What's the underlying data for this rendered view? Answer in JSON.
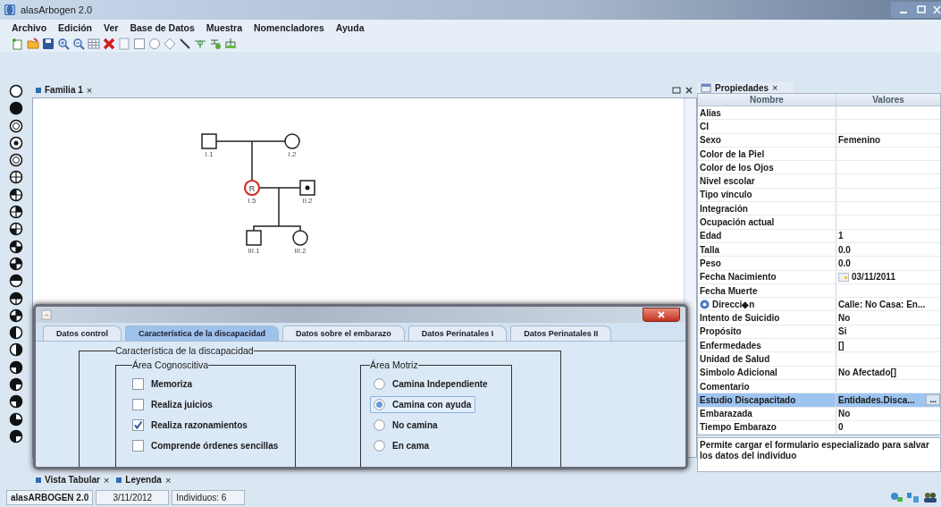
{
  "window": {
    "title": "alasArbogen 2.0"
  },
  "menu": [
    "Archivo",
    "Edición",
    "Ver",
    "Base de Datos",
    "Muestra",
    "Nomencladores",
    "Ayuda"
  ],
  "document_tab": {
    "label": "Familia 1",
    "close": "×"
  },
  "pedigree": {
    "individuals": [
      {
        "label": "I.1",
        "kind": "male",
        "affected": false,
        "highlighted": false
      },
      {
        "label": "I.2",
        "kind": "female",
        "affected": false,
        "highlighted": false
      },
      {
        "label": "I.5",
        "kind": "female",
        "affected": false,
        "highlighted": true,
        "marker": "R"
      },
      {
        "label": "II.2",
        "kind": "male",
        "affected": true,
        "highlighted": false
      },
      {
        "label": "III.1",
        "kind": "male",
        "affected": false,
        "highlighted": false
      },
      {
        "label": "III.2",
        "kind": "female",
        "affected": false,
        "highlighted": false
      }
    ]
  },
  "dialog": {
    "tabs": [
      {
        "label": "Datos control",
        "selected": false
      },
      {
        "label": "Característica de la discapacidad",
        "selected": true
      },
      {
        "label": "Datos sobre el embarazo",
        "selected": false
      },
      {
        "label": "Datos Perinatales I",
        "selected": false
      },
      {
        "label": "Datos Perinatales II",
        "selected": false
      }
    ],
    "frame_title": "Característica de la discapacidad",
    "groups": [
      {
        "title": "Área Cognoscitiva",
        "kind": "checkbox",
        "options": [
          {
            "label": "Memoriza",
            "checked": false
          },
          {
            "label": "Realiza juicios",
            "checked": false
          },
          {
            "label": "Realiza razonamientos",
            "checked": true
          },
          {
            "label": "Comprende órdenes sencillas",
            "checked": false
          }
        ]
      },
      {
        "title": "Área Motriz",
        "kind": "radio",
        "options": [
          {
            "label": "Camina Independiente",
            "selected": false
          },
          {
            "label": "Camina con ayuda",
            "selected": true
          },
          {
            "label": "No camina",
            "selected": false
          },
          {
            "label": "En cama",
            "selected": false
          }
        ]
      }
    ]
  },
  "properties": {
    "tab": "Propiedades",
    "close": "×",
    "columns": [
      "Nombre",
      "Valores"
    ],
    "rows": [
      {
        "name": "Alias",
        "value": "",
        "kind": "plain",
        "selected": false
      },
      {
        "name": "CI",
        "value": "",
        "kind": "plain",
        "selected": false
      },
      {
        "name": "Sexo",
        "value": "Femenino",
        "kind": "plain",
        "selected": false
      },
      {
        "name": "Color de la Piel",
        "value": "",
        "kind": "plain",
        "selected": false
      },
      {
        "name": "Color de los Ojos",
        "value": "",
        "kind": "plain",
        "selected": false
      },
      {
        "name": "Nivel escolar",
        "value": "",
        "kind": "plain",
        "selected": false
      },
      {
        "name": "Tipo vínculo",
        "value": "",
        "kind": "plain",
        "selected": false
      },
      {
        "name": "Integración",
        "value": "",
        "kind": "plain",
        "selected": false
      },
      {
        "name": "Ocupación actual",
        "value": "",
        "kind": "plain",
        "selected": false
      },
      {
        "name": "Edad",
        "value": "1",
        "kind": "plain",
        "selected": false
      },
      {
        "name": "Talla",
        "value": "0.0",
        "kind": "plain",
        "selected": false
      },
      {
        "name": "Peso",
        "value": "0.0",
        "kind": "plain",
        "selected": false
      },
      {
        "name": "Fecha Nacimiento",
        "value": "03/11/2011",
        "kind": "date",
        "selected": false
      },
      {
        "name": "Fecha Muerte",
        "value": "",
        "kind": "plain",
        "selected": false
      },
      {
        "name": "Direcci◆n",
        "value": "Calle:  No Casa:  En...",
        "kind": "group",
        "selected": false
      },
      {
        "name": "Intento de Suicidio",
        "value": "No",
        "kind": "plain",
        "selected": false
      },
      {
        "name": "Propósito",
        "value": "Si",
        "kind": "plain",
        "selected": false
      },
      {
        "name": "Enfermedades",
        "value": "[]",
        "kind": "plain",
        "selected": false
      },
      {
        "name": "Unidad de Salud",
        "value": "",
        "kind": "plain",
        "selected": false
      },
      {
        "name": "Simbolo Adicional",
        "value": "No Afectado[]",
        "kind": "plain",
        "selected": false
      },
      {
        "name": "Comentario",
        "value": "",
        "kind": "plain",
        "selected": false
      },
      {
        "name": "Estudio Discapacitado",
        "value": "Entidades.Disca...",
        "kind": "editor",
        "button": "...",
        "selected": true
      },
      {
        "name": "Embarazada",
        "value": "No",
        "kind": "plain",
        "selected": false
      },
      {
        "name": "Tiempo Embarazo",
        "value": "0",
        "kind": "plain",
        "selected": false
      }
    ],
    "description": "Permite cargar el formulario especializado para salvar los datos del individuo"
  },
  "bottom_tabs": [
    {
      "label": "Vista Tabular",
      "close": "×"
    },
    {
      "label": "Leyenda",
      "close": "×"
    }
  ],
  "status_bar": [
    "alasARBOGEN 2.0",
    "3/11/2012",
    "Individuos: 6"
  ]
}
